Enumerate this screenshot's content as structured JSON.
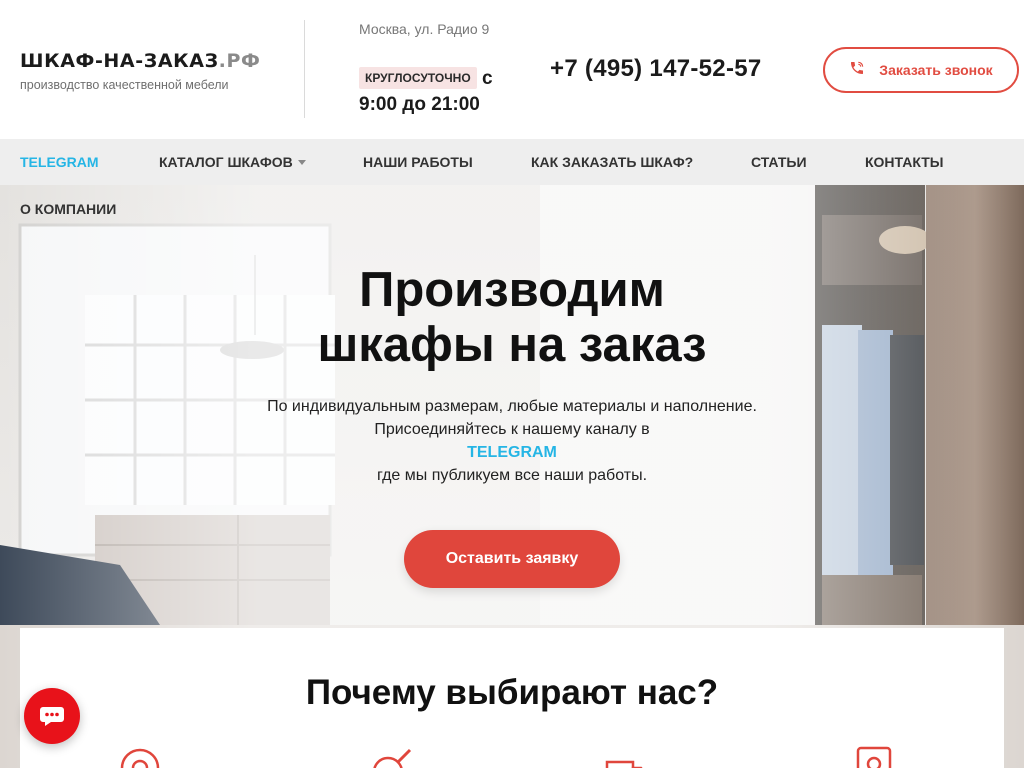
{
  "header": {
    "logo_main": "ШКАФ-НА-ЗАКАЗ",
    "logo_tld": ".РФ",
    "tagline": "производство качественной мебели",
    "address": "Москва, ул. Радио 9",
    "hours_badge": "КРУГЛОСУТОЧНО",
    "hours_text": "с 9:00 до 21:00",
    "phone": "+7 (495) 147-52-57",
    "callback_label": "Заказать звонок"
  },
  "nav": {
    "items": [
      {
        "label": "TELEGRAM"
      },
      {
        "label": "КАТАЛОГ ШКАФОВ"
      },
      {
        "label": "НАШИ РАБОТЫ"
      },
      {
        "label": "КАК ЗАКАЗАТЬ ШКАФ?"
      },
      {
        "label": "СТАТЬИ"
      },
      {
        "label": "КОНТАКТЫ"
      },
      {
        "label": "О КОМПАНИИ"
      }
    ]
  },
  "hero": {
    "title_line1": "Производим",
    "title_line2": "шкафы на заказ",
    "text_line1": "По индивидуальным размерам, любые материалы и наполнение.",
    "text_line2": "Присоединяйтесь к нашему каналу в",
    "telegram_link": "TELEGRAM",
    "text_line3": "где мы публикуем все наши работы.",
    "cta_label": "Оставить заявку"
  },
  "why": {
    "title": "Почему выбирают нас?"
  },
  "colors": {
    "accent_red": "#e0463c",
    "accent_blue": "#25b5e5",
    "chat_red": "#e8121a",
    "nav_bg": "#eeeeee"
  },
  "icons": [
    "phone-icon",
    "nav-caret-icon",
    "tape-measure-icon",
    "frying-pan-icon",
    "delivery-truck-icon",
    "certificate-icon",
    "chat-icon"
  ]
}
